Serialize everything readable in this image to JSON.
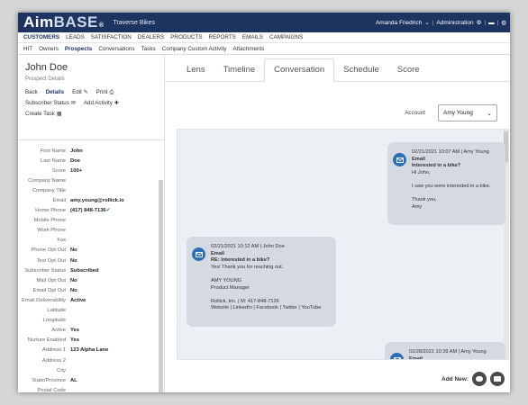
{
  "header": {
    "logo_main": "Aim",
    "logo_accent": "BASE",
    "logo_mark": "®",
    "brand": "Traverse Bikes",
    "user": "Amanda Friedrich",
    "user_chev": "⌄",
    "admin": "Administration",
    "admin_icon": "gear-icon",
    "sep": "|"
  },
  "nav1": [
    "CUSTOMERS",
    "LEADS",
    "SATISFACTION",
    "DEALERS",
    "PRODUCTS",
    "REPORTS",
    "EMAILS",
    "CAMPAIGNS"
  ],
  "nav2": [
    "HIT",
    "Owners",
    "Prospects",
    "Conversations",
    "Tasks",
    "Company Custom Activity",
    "Attachments"
  ],
  "person": {
    "name": "John Doe",
    "subtitle": "Prospect Details"
  },
  "actions": {
    "back": "Back",
    "details": "Details",
    "edit": "Edit",
    "print": "Print",
    "subscriber_status": "Subscriber Status",
    "add_activity": "Add Activity",
    "create_task": "Create Task"
  },
  "fields": [
    {
      "label": "First Name",
      "value": "John"
    },
    {
      "label": "Last Name",
      "value": "Doe"
    },
    {
      "label": "Score",
      "value": "100+"
    },
    {
      "label": "Company Name",
      "value": ""
    },
    {
      "label": "Company Title",
      "value": ""
    },
    {
      "label": "Email",
      "value": "amy.young@rollick.io"
    },
    {
      "label": "Home Phone",
      "value": "(417) 848-7136"
    },
    {
      "label": "Mobile Phone",
      "value": ""
    },
    {
      "label": "Work Phone",
      "value": ""
    },
    {
      "label": "Fax",
      "value": ""
    },
    {
      "label": "Phone Opt Out",
      "value": "No"
    },
    {
      "label": "Text Opt Out",
      "value": "No"
    },
    {
      "label": "Subscriber Status",
      "value": "Subscribed"
    },
    {
      "label": "Mail Opt Out",
      "value": "No"
    },
    {
      "label": "Email Opt Out",
      "value": "No"
    },
    {
      "label": "Email Deliverability",
      "value": "Active"
    },
    {
      "label": "Latitude",
      "value": ""
    },
    {
      "label": "Longitude",
      "value": ""
    },
    {
      "label": "Active",
      "value": "Yes"
    },
    {
      "label": "Nurture Enabled",
      "value": "Yes"
    },
    {
      "label": "Address 1",
      "value": "123 Alpha Lane"
    },
    {
      "label": "Address 2",
      "value": ""
    },
    {
      "label": "City",
      "value": ""
    },
    {
      "label": "State/Province",
      "value": "AL"
    },
    {
      "label": "Postal Code",
      "value": ""
    }
  ],
  "tabs": [
    "Lens",
    "Timeline",
    "Conversation",
    "Schedule",
    "Score"
  ],
  "account": {
    "label": "Account",
    "selected": "Amy Young"
  },
  "messages": [
    {
      "meta": "02/21/2021 10:07 AM | Amy Young",
      "type": "Email",
      "subject": "Interested in a bike?",
      "lines": [
        "Hi John,",
        "",
        "I saw you were interested in a bike.",
        "",
        "Thank you,",
        "Amy"
      ]
    },
    {
      "meta": "02/21/2021 10:12 AM | John Doe",
      "type": "Email",
      "subject": "RE: Interested in a bike?",
      "lines": [
        "Yes! Thank you for reaching out.",
        "",
        "AMY YOUNG",
        "Product Manager",
        "",
        "Rollick, Inc. | M: 417-848-7136",
        "Website | LinkedIn | Facebook | Twitter | YouTube"
      ]
    },
    {
      "meta": "02/28/2021 10:39 AM | Amy Young",
      "type": "Email",
      "subject": "",
      "lines": []
    }
  ],
  "add_new": "Add New:"
}
